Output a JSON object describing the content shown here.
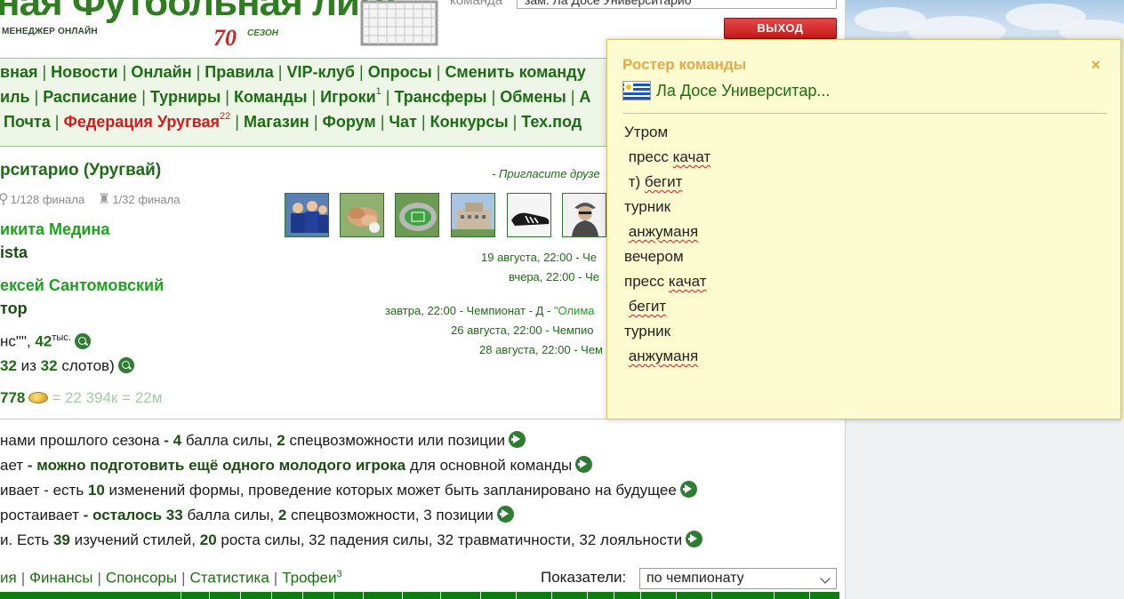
{
  "header": {
    "logo_title": "ная Футбольная лига",
    "logo_subtitle": "МЕНЕДЖЕР ОНЛАЙН",
    "season_number": "70",
    "season_label": "СЕЗОН",
    "team_label": "команда",
    "team_select_value": "зам. Ла Досе Университарио",
    "exit_label": "ВЫХОД"
  },
  "nav": {
    "row1": [
      "вная",
      "Новости",
      "Онлайн",
      "Правила",
      "VIP-клуб",
      "Опросы",
      "Сменить команду"
    ],
    "row2": [
      "иль",
      "Расписание",
      "Турниры",
      "Команды",
      "Игроки",
      "Трансферы",
      "Обмены",
      "А"
    ],
    "row2_players_count": "1",
    "row3": [
      "Почта",
      "Федерация Уругвая",
      "Магазин",
      "Форум",
      "Чат",
      "Конкурсы",
      "Тех.под"
    ],
    "row3_federation_count": "22"
  },
  "team": {
    "name": "рситарио (Уругвай)",
    "invite": "- Пригласите друзе",
    "cup1": "1/128 финала",
    "cup2": "1/32 финала",
    "manager_name": "икита Медина",
    "manager_role": "ista",
    "assistant_name": "ексей Сантомовский",
    "assistant_role": "тор"
  },
  "matches": [
    {
      "date": "19 августа, 22:00 - Че"
    },
    {
      "date": "вчера, 22:00 - Че"
    },
    {
      "date": "завтра, 22:00 - Чемпионат - Д - ",
      "opponent": "\"Олима"
    },
    {
      "date": "26 августа, 22:00 - Чемпио"
    },
    {
      "date": "28 августа, 22:00 - Чем"
    }
  ],
  "stats": {
    "sponsor_pre": "нс\"\", ",
    "sponsor_value": "42",
    "sponsor_unit": "тыс.",
    "slots_used": "32",
    "slots_mid": " из ",
    "slots_total": "32",
    "slots_post": " слотов)",
    "money_value": "778",
    "money_conv": "= 22 394к = 22м"
  },
  "info": [
    {
      "pre": "нами прошлого сезона ",
      "b1": "- 4",
      "t1": " балла силы, ",
      "b2": "2",
      "t2": " спецвозможности или позиции"
    },
    {
      "pre": "ает ",
      "b1": "- можно подготовить ещё одного молодого игрока",
      "t1": " для основной команды",
      "b2": "",
      "t2": ""
    },
    {
      "pre": "ивает - есть ",
      "b1": "10",
      "t1": " изменений формы, проведение которых может быть запланировано на будущее",
      "b2": "",
      "t2": ""
    },
    {
      "pre": "ростаивает ",
      "b1": "- осталось 33",
      "t1": " балла силы, ",
      "b2": "2",
      "t2": " спецвозможности, 3 позиции"
    },
    {
      "pre": "и. Есть ",
      "b1": "39",
      "t1": " изучений стилей, ",
      "b2": "20",
      "t2": " роста силы, 32 падения силы, 32 травматичности, 32 лояльности"
    }
  ],
  "tabs": {
    "items": [
      "ия",
      "Финансы",
      "Спонсоры",
      "Статистика",
      "Трофеи"
    ],
    "trophies_count": "3",
    "metric_label": "Показатели:",
    "metric_value": "по чемпионату"
  },
  "popup": {
    "title": "Ростер команды",
    "close": "×",
    "team": "Ла Досе Университар...",
    "lines": [
      "Утром",
      " пресс качат",
      " т) бегит",
      "турник",
      " анжуманя",
      "вечером",
      "пресс качат",
      " бегит",
      "турник",
      " анжуманя"
    ]
  },
  "colors": {
    "brand_green": "#1b6d12",
    "bright_green": "#1da21d",
    "accent_red": "#d61a1a",
    "popup_bg": "#fdfbd0",
    "popup_title": "#e6a84a",
    "exit_button": "#c41a1a"
  },
  "icons": {
    "magnifier": "search-icon",
    "arrow": "arrow-right-icon",
    "close": "close-icon",
    "flag": "uruguay-flag-icon",
    "coin": "coin-icon",
    "trophy": "trophy-icon"
  }
}
